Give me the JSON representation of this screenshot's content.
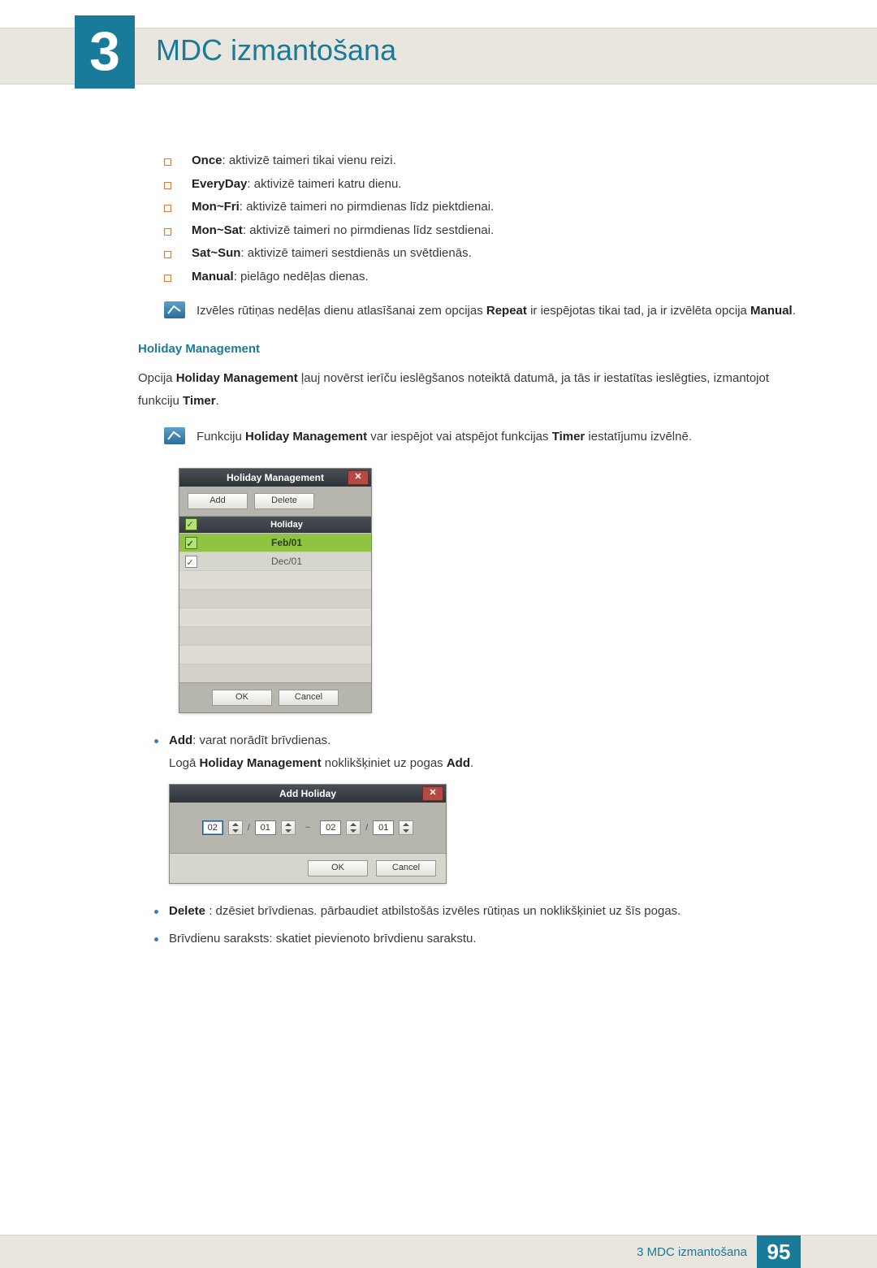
{
  "chapter": {
    "number": "3",
    "title": "MDC izmantošana"
  },
  "options": [
    {
      "term": "Once",
      "desc": ": aktivizē taimeri tikai vienu reizi."
    },
    {
      "term": "EveryDay",
      "desc": ": aktivizē taimeri katru dienu."
    },
    {
      "term": "Mon~Fri",
      "desc": ": aktivizē taimeri no pirmdienas līdz piektdienai."
    },
    {
      "term": "Mon~Sat",
      "desc": ": aktivizē taimeri no pirmdienas līdz sestdienai."
    },
    {
      "term": "Sat~Sun",
      "desc": ": aktivizē taimeri sestdienās un svētdienās."
    },
    {
      "term": "Manual",
      "desc": ": pielāgo nedēļas dienas."
    }
  ],
  "note1_pre": "Izvēles rūtiņas nedēļas dienu atlasīšanai zem opcijas ",
  "note1_b1": "Repeat",
  "note1_mid": " ir iespējotas tikai tad, ja ir izvēlēta opcija ",
  "note1_b2": "Manual",
  "note1_end": ".",
  "section_holiday": "Holiday Management",
  "holiday_para_pre": "Opcija ",
  "holiday_para_b1": "Holiday Management",
  "holiday_para_mid": " ļauj novērst ierīču ieslēgšanos noteiktā datumā, ja tās ir iestatītas ieslēgties, izmantojot funkciju ",
  "holiday_para_b2": "Timer",
  "holiday_para_end": ".",
  "note2_pre": "Funkciju ",
  "note2_b1": "Holiday Management",
  "note2_mid": " var iespējot vai atspējot funkcijas ",
  "note2_b2": "Timer",
  "note2_end": " iestatījumu izvēlnē.",
  "hm_dialog": {
    "title": "Holiday Management",
    "add": "Add",
    "delete": "Delete",
    "holiday_header": "Holiday",
    "rows": [
      {
        "date": "Feb/01",
        "selected": true
      },
      {
        "date": "Dec/01",
        "selected": false
      }
    ],
    "ok": "OK",
    "cancel": "Cancel"
  },
  "bullets": {
    "add_term": "Add",
    "add_desc": ": varat norādīt brīvdienas.",
    "add_line2_pre": "Logā ",
    "add_line2_b1": "Holiday Management",
    "add_line2_mid": " noklikšķiniet uz pogas ",
    "add_line2_b2": "Add",
    "add_line2_end": ".",
    "delete_term": "Delete",
    "delete_desc": " : dzēsiet brīvdienas. pārbaudiet atbilstošās izvēles rūtiņas un noklikšķiniet uz šīs pogas.",
    "list_desc": "Brīvdienu saraksts: skatiet pievienoto brīvdienu sarakstu."
  },
  "ah_dialog": {
    "title": "Add Holiday",
    "m1": "02",
    "d1": "01",
    "m2": "02",
    "d2": "01",
    "ok": "OK",
    "cancel": "Cancel"
  },
  "footer": {
    "text": "3 MDC izmantošana",
    "page": "95"
  }
}
